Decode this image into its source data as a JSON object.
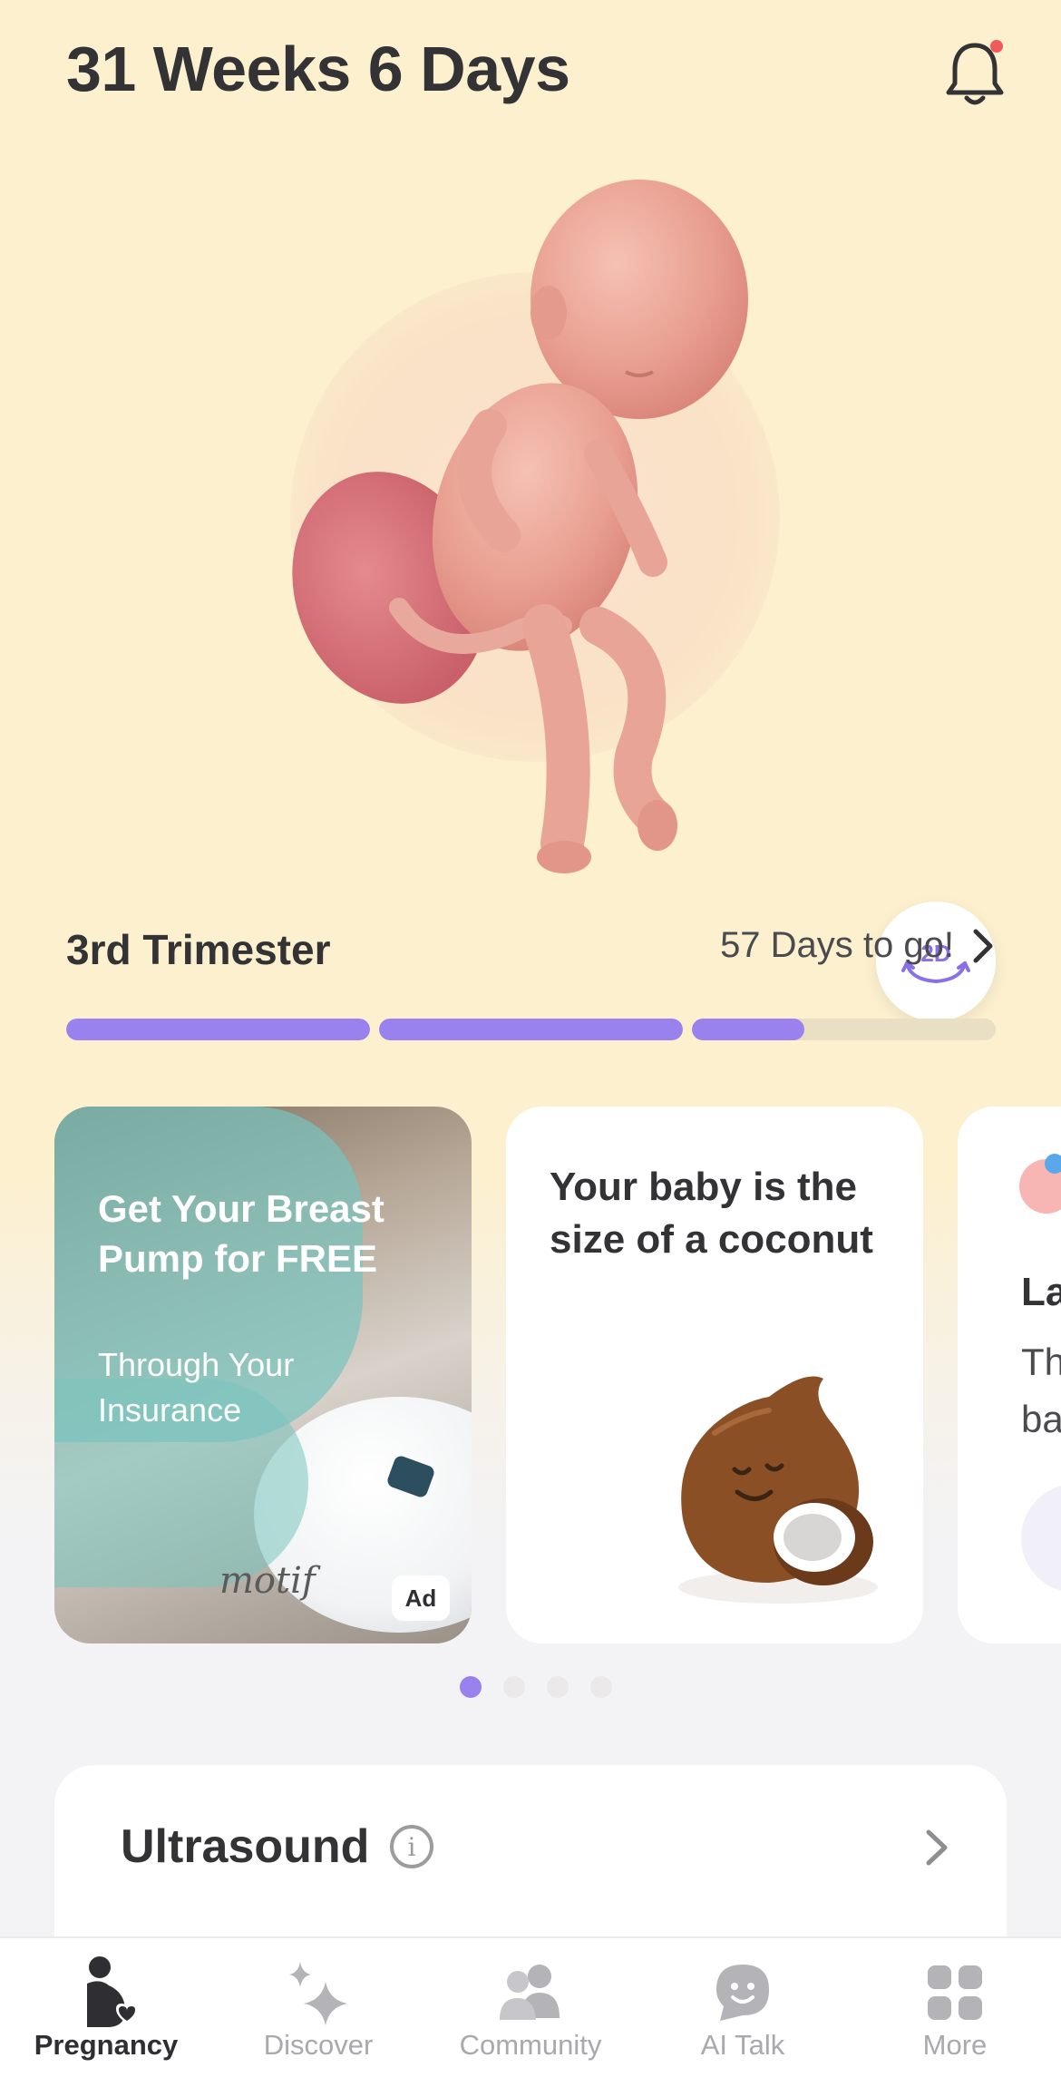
{
  "header": {
    "title": "31 Weeks 6 Days",
    "notification_icon": "bell-icon",
    "has_unread": true
  },
  "hero": {
    "image": "fetus-3d-illustration",
    "view_toggle_label": "2D",
    "view_toggle_icon": "rotate-2d-icon"
  },
  "trimester": {
    "label": "3rd Trimester",
    "days_to_go": "57 Days to go!",
    "progress": [
      1.0,
      1.0,
      0.37
    ],
    "accent": "#9a82ee"
  },
  "cards": [
    {
      "type": "ad",
      "headline": "Get Your Breast Pump for FREE",
      "subtext": "Through Your Insurance",
      "logo": "motif",
      "badge": "Ad"
    },
    {
      "type": "size",
      "title": "Your baby is the size of a coconut",
      "image": "coconut-icon"
    },
    {
      "type": "partial",
      "title": "La",
      "text_line1": "Th",
      "text_line2": "ba"
    }
  ],
  "carousel": {
    "page_count": 4,
    "active_index": 0
  },
  "ultrasound": {
    "title": "Ultrasound",
    "info_icon": "info-icon",
    "chevron_icon": "chevron-right-icon"
  },
  "tabbar": {
    "tabs": [
      {
        "label": "Pregnancy",
        "icon": "pregnancy-icon",
        "active": true
      },
      {
        "label": "Discover",
        "icon": "sparkles-icon",
        "active": false
      },
      {
        "label": "Community",
        "icon": "people-icon",
        "active": false
      },
      {
        "label": "AI Talk",
        "icon": "chat-smile-icon",
        "active": false
      },
      {
        "label": "More",
        "icon": "grid-icon",
        "active": false
      }
    ]
  }
}
